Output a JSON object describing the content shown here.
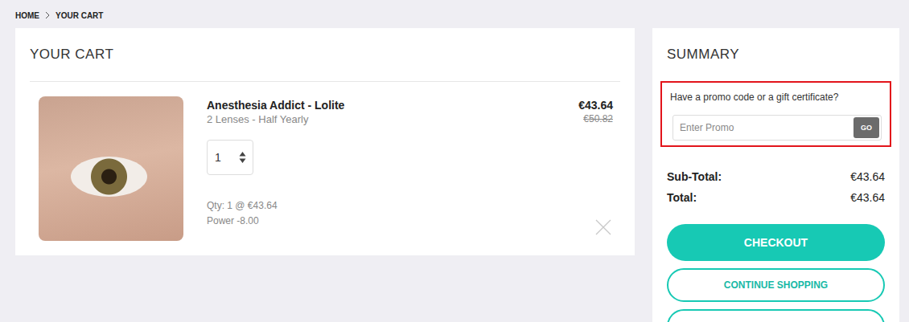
{
  "breadcrumb": [
    {
      "label": "HOME"
    },
    {
      "label": "YOUR CART"
    }
  ],
  "cart": {
    "title": "YOUR CART",
    "items": [
      {
        "name": "Anesthesia Addict - Lolite",
        "variant": "2 Lenses - Half Yearly",
        "quantity": "1",
        "price": "€43.64",
        "old_price": "€50.82",
        "details": [
          "Qty: 1 @ €43.64",
          "Power -8.00"
        ]
      }
    ]
  },
  "summary": {
    "title": "SUMMARY",
    "promo": {
      "prompt": "Have a promo code or a gift certificate?",
      "placeholder": "Enter Promo",
      "button": "GO",
      "highlighted": true
    },
    "rows": [
      {
        "label": "Sub-Total:",
        "value": "€43.64"
      },
      {
        "label": "Total:",
        "value": "€43.64"
      }
    ],
    "buttons": [
      {
        "label": "CHECKOUT",
        "kind": "primary"
      },
      {
        "label": "CONTINUE SHOPPING",
        "kind": "outline"
      },
      {
        "label": "",
        "kind": "outline"
      }
    ]
  }
}
